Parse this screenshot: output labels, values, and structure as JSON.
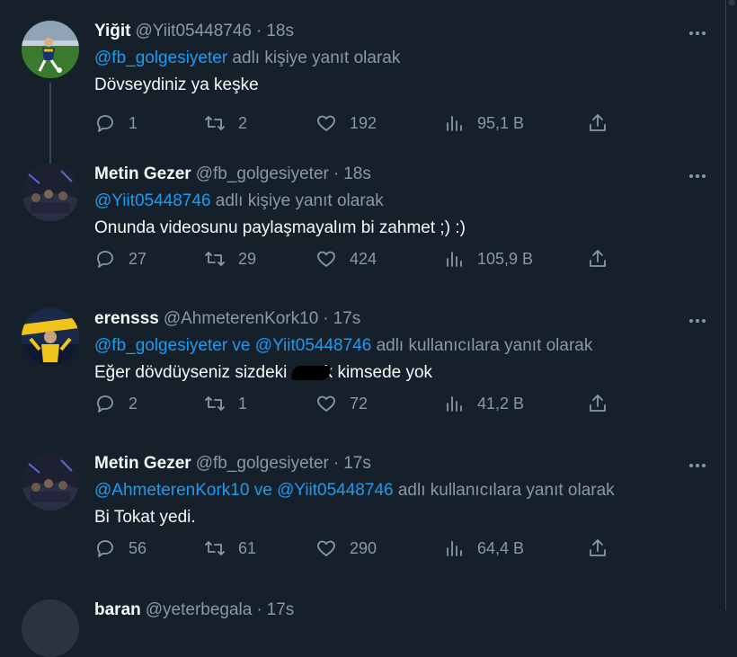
{
  "tweets": [
    {
      "name": "Yiğit",
      "handle": "@Yiit05448746",
      "dot": "·",
      "time": "18s",
      "reply_mention": "@fb_golgesiyeter",
      "reply_suffix": " adlı kişiye yanıt olarak",
      "text": "Dövseydiniz ya keşke",
      "replies": "1",
      "retweets": "2",
      "likes": "192",
      "views": "95,1 B"
    },
    {
      "name": "Metin Gezer",
      "handle": "@fb_golgesiyeter",
      "dot": "·",
      "time": "18s",
      "reply_mention": "@Yiit05448746",
      "reply_suffix": " adlı kişiye yanıt olarak",
      "text": "Onunda videosunu paylaşmayalım bi zahmet ;) :)",
      "replies": "27",
      "retweets": "29",
      "likes": "424",
      "views": "105,9 B"
    },
    {
      "name": "erensss",
      "handle": "@AhmeterenKork10",
      "dot": "·",
      "time": "17s",
      "reply_mention": "@fb_golgesiyeter",
      "reply_joiner": " ve ",
      "reply_mention2": "@Yiit05448746",
      "reply_suffix": " adlı kullanıcılara yanıt olarak",
      "text_before": "Eğer dövdüyseniz sizdeki ",
      "text_after": "k kimsede yok",
      "replies": "2",
      "retweets": "1",
      "likes": "72",
      "views": "41,2 B"
    },
    {
      "name": "Metin Gezer",
      "handle": "@fb_golgesiyeter",
      "dot": "·",
      "time": "17s",
      "reply_mention": "@AhmeterenKork10",
      "reply_joiner": " ve ",
      "reply_mention2": "@Yiit05448746",
      "reply_suffix": " adlı kullanıcılara yanıt olarak",
      "text": "Bi Tokat yedi.",
      "replies": "56",
      "retweets": "61",
      "likes": "290",
      "views": "64,4 B"
    },
    {
      "name": "baran",
      "handle": "@yeterbegala",
      "dot": "·",
      "time": "17s"
    }
  ],
  "colors": {
    "background": "#15202b",
    "text": "#f7f9f9",
    "secondary": "#8b98a5",
    "accent": "#1d9bf0",
    "divider": "#38444d"
  }
}
